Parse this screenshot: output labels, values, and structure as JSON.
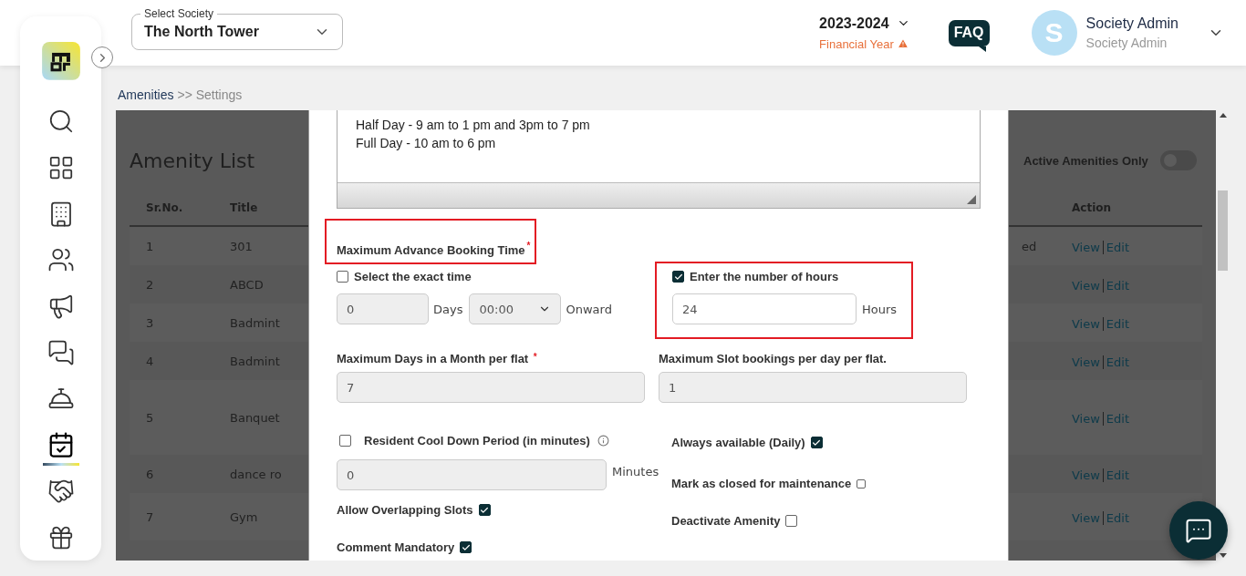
{
  "society_select": {
    "label": "Select Society",
    "value": "The North Tower"
  },
  "financial_year": {
    "value": "2023-2024",
    "label": "Financial Year"
  },
  "faq": "FAQ",
  "user": {
    "initial": "S",
    "name": "Society Admin",
    "role": "Society Admin"
  },
  "sidebar": {
    "items": [
      {
        "kind": "search",
        "selected": false
      },
      {
        "kind": "dashboard",
        "selected": false
      },
      {
        "kind": "building",
        "selected": false
      },
      {
        "kind": "people",
        "selected": false
      },
      {
        "kind": "megaphone",
        "selected": false
      },
      {
        "kind": "chat",
        "selected": false
      },
      {
        "kind": "reception",
        "selected": false
      },
      {
        "kind": "calendar",
        "selected": true
      },
      {
        "kind": "handshake",
        "selected": false
      },
      {
        "kind": "box",
        "selected": false
      }
    ]
  },
  "breadcrumb": {
    "link": "Amenities",
    "current": ">> Settings"
  },
  "amenity_list": {
    "title": "Amenity List",
    "filter": {
      "label": "Active Amenities Only",
      "on": false
    },
    "columns": [
      "Sr.No.",
      "Title",
      "Action"
    ],
    "rows": [
      {
        "sr": "1",
        "title": "301",
        "column_3": "ed",
        "actions": [
          "View",
          "Edit"
        ]
      },
      {
        "sr": "2",
        "title": "ABCD",
        "actions": [
          "View",
          "Edit"
        ]
      },
      {
        "sr": "3",
        "title": "Badmint",
        "actions": [
          "View",
          "Edit"
        ]
      },
      {
        "sr": "4",
        "title": "Badmint",
        "actions": [
          "View",
          "Edit"
        ]
      },
      {
        "sr": "5",
        "title": "Banquet",
        "actions": [
          "View",
          "Edit"
        ]
      },
      {
        "sr": "6",
        "title": "dance ro",
        "actions": [
          "View",
          "Edit"
        ]
      },
      {
        "sr": "7",
        "title": "Gym",
        "actions": [
          "View",
          "Edit"
        ]
      }
    ]
  },
  "modal": {
    "description_lines": [
      "Half Day - 9 am to 1 pm and 3pm to 7 pm",
      "Full Day - 10 am to 6 pm"
    ],
    "advance_booking": {
      "label": "Maximum Advance Booking Time",
      "mark": "*",
      "highlighted": true,
      "exact_time": {
        "label": "Select the exact time",
        "checked": false,
        "days": "0",
        "days_unit": "Days",
        "time": "00:00",
        "suffix": "Onward"
      },
      "hours": {
        "label": "Enter the number of hours",
        "checked": true,
        "highlighted": true,
        "value": "24",
        "unit": "Hours"
      }
    },
    "max_days": {
      "label": "Maximum Days in a Month per flat",
      "mark": "*",
      "value": "7"
    },
    "max_slots": {
      "label": "Maximum Slot bookings per day per flat.",
      "value": "1"
    },
    "cool_down": {
      "label": "Resident Cool Down Period (in minutes)",
      "checked": false,
      "value": "0",
      "unit": "Minutes"
    },
    "left_options": [
      {
        "label": "Allow Overlapping Slots",
        "checked": true,
        "kind": "normal"
      },
      {
        "label": "Comment Mandatory",
        "checked": true,
        "kind": "normal"
      }
    ],
    "right_options": [
      {
        "label": "Always available (Daily)",
        "checked": true,
        "kind": "normal"
      },
      {
        "label": "Mark as closed for maintenance",
        "checked": false,
        "kind": "small"
      },
      {
        "label": "Deactivate Amenity",
        "checked": false,
        "kind": "normal"
      }
    ]
  }
}
